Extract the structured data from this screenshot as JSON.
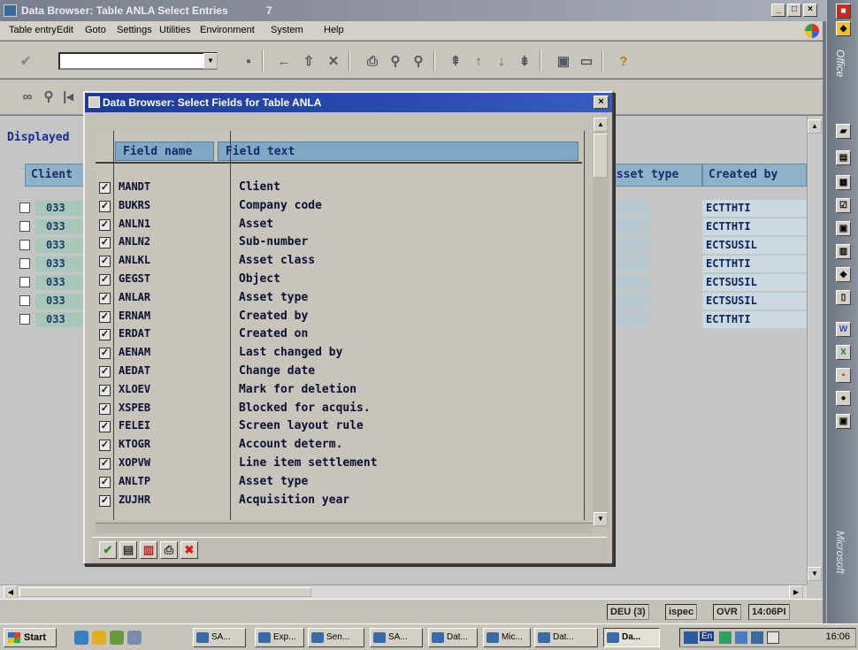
{
  "main_window": {
    "title": "Data Browser: Table ANLA Select Entries",
    "title_suffix": "7",
    "menu": [
      "Table entry",
      "Edit",
      "Goto",
      "Settings",
      "Utilities",
      "Environment",
      "System",
      "Help"
    ],
    "displayed_label": "Displayed",
    "table": {
      "headers": {
        "client": "Client",
        "asset_type": "Asset type",
        "created_by": "Created by"
      },
      "rows": [
        {
          "client": "033",
          "created_by": "ECTTHTI"
        },
        {
          "client": "033",
          "created_by": "ECTTHTI"
        },
        {
          "client": "033",
          "created_by": "ECTSUSIL"
        },
        {
          "client": "033",
          "created_by": "ECTTHTI"
        },
        {
          "client": "033",
          "created_by": "ECTSUSIL"
        },
        {
          "client": "033",
          "created_by": "ECTSUSIL"
        },
        {
          "client": "033",
          "created_by": "ECTTHTI"
        }
      ]
    },
    "status": {
      "system": "DEU (3)",
      "server": "ispec",
      "mode": "OVR",
      "time": "14:06PI"
    }
  },
  "dialog": {
    "title": "Data Browser: Select Fields for Table ANLA",
    "close_label": "×",
    "col_field_name": "Field name",
    "col_field_text": "Field text",
    "fields": [
      {
        "name": "MANDT",
        "text": "Client",
        "checked": true
      },
      {
        "name": "BUKRS",
        "text": "Company code",
        "checked": true
      },
      {
        "name": "ANLN1",
        "text": "Asset",
        "checked": true
      },
      {
        "name": "ANLN2",
        "text": "Sub-number",
        "checked": true
      },
      {
        "name": "ANLKL",
        "text": "Asset class",
        "checked": true
      },
      {
        "name": "GEGST",
        "text": "Object",
        "checked": true
      },
      {
        "name": "ANLAR",
        "text": "Asset type",
        "checked": true
      },
      {
        "name": "ERNAM",
        "text": "Created by",
        "checked": true
      },
      {
        "name": "ERDAT",
        "text": "Created on",
        "checked": true
      },
      {
        "name": "AENAM",
        "text": "Last changed by",
        "checked": true
      },
      {
        "name": "AEDAT",
        "text": "Change date",
        "checked": true
      },
      {
        "name": "XLOEV",
        "text": "Mark for deletion",
        "checked": true
      },
      {
        "name": "XSPEB",
        "text": "Blocked for acquis.",
        "checked": true
      },
      {
        "name": "FELEI",
        "text": "Screen layout rule",
        "checked": true
      },
      {
        "name": "KTOGR",
        "text": "Account determ.",
        "checked": true
      },
      {
        "name": "XOPVW",
        "text": "Line item settlement",
        "checked": true
      },
      {
        "name": "ANLTP",
        "text": "Asset type",
        "checked": true
      },
      {
        "name": "ZUJHR",
        "text": "Acquisition year",
        "checked": true
      }
    ],
    "buttons": [
      {
        "icon": "checkmark-icon",
        "glyph": "✔",
        "color": "#2a8a2a"
      },
      {
        "icon": "select-all-icon",
        "glyph": "▤",
        "color": "#303030"
      },
      {
        "icon": "deselect-all-icon",
        "glyph": "▥",
        "color": "#c02020"
      },
      {
        "icon": "print-icon",
        "glyph": "⎙",
        "color": "#303030"
      },
      {
        "icon": "cancel-icon",
        "glyph": "✖",
        "color": "#d02020"
      }
    ]
  },
  "office_bar": {
    "label": "Office",
    "brand": "Microsoft"
  },
  "taskbar": {
    "start_label": "Start",
    "tasks": [
      "SA...",
      "Exp...",
      "Sen...",
      "SA...",
      "Dat...",
      "Mic...",
      "Dat...",
      "Da..."
    ],
    "tray_lang": "En",
    "clock": "16:06"
  },
  "colors": {
    "title_active": "#2a4ab0",
    "header_blue": "#7ea8c6",
    "client_green": "#a9c7b9"
  }
}
